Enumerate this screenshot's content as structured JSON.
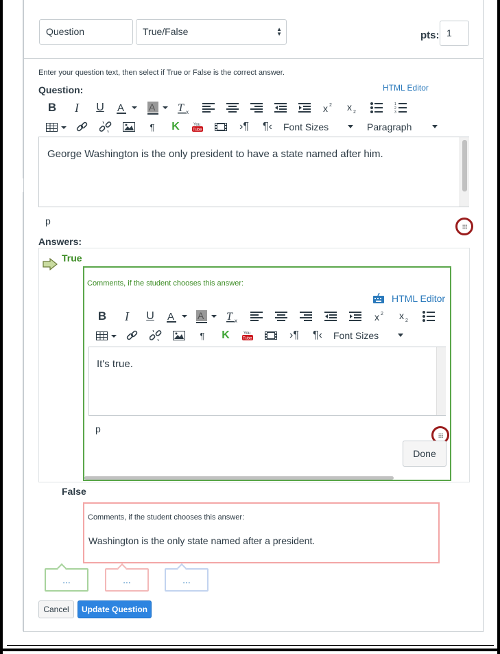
{
  "question": {
    "name_value": "Question",
    "type_value": "True/False",
    "pts_label": "pts:",
    "pts_value": "1",
    "instructions": "Enter your question text, then select if True or False is the correct answer.",
    "label": "Question:",
    "html_editor_link": "HTML Editor",
    "text": "George Washington is the only president to have a state named after him.",
    "status_path": "p"
  },
  "toolbar": {
    "font_sizes_label": "Font Sizes",
    "paragraph_label": "Paragraph"
  },
  "answers": {
    "label": "Answers:",
    "true": {
      "label": "True",
      "comment_label": "Comments, if the student chooses this answer:",
      "html_editor_link": "HTML Editor",
      "comment_text": "It's true.",
      "status_path": "p",
      "done_label": "Done"
    },
    "false": {
      "label": "False",
      "comment_label": "Comments, if the student chooses this answer:",
      "comment_text": "Washington is the only state named after a president."
    },
    "bubble_text": "..."
  },
  "buttons": {
    "cancel": "Cancel",
    "update": "Update Question"
  },
  "colors": {
    "correct_green": "#3a8b22",
    "true_border": "#5aa64a",
    "false_border": "#f3a6a6",
    "link_blue": "#2b7abc",
    "primary_blue": "#2d84e0",
    "resize_ring": "#9a1c1c"
  }
}
